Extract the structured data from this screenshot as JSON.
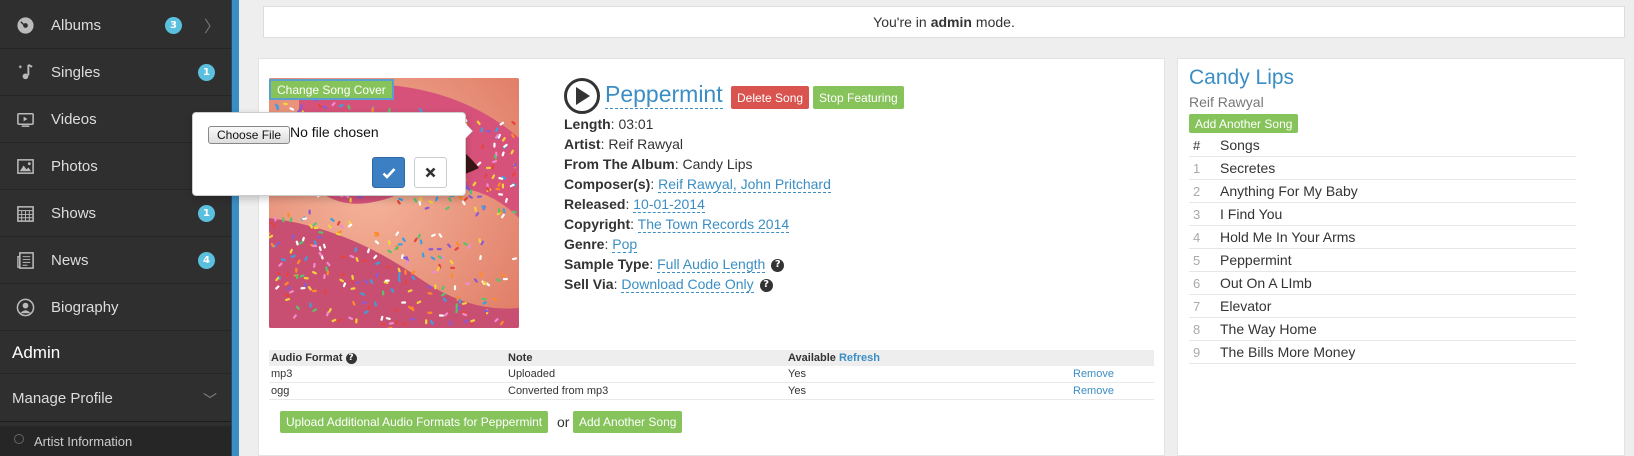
{
  "sidebar": {
    "items": [
      {
        "label": "Albums",
        "icon": "disc-icon",
        "badge": "3",
        "chevron": "〉"
      },
      {
        "label": "Singles",
        "icon": "music-note-icon",
        "badge": "1"
      },
      {
        "label": "Videos",
        "icon": "video-icon",
        "badge": ""
      },
      {
        "label": "Photos",
        "icon": "photo-icon",
        "badge": ""
      },
      {
        "label": "Shows",
        "icon": "calendar-icon",
        "badge": "1"
      },
      {
        "label": "News",
        "icon": "newspaper-icon",
        "badge": "4"
      },
      {
        "label": "Biography",
        "icon": "person-icon",
        "badge": ""
      }
    ],
    "admin_label": "Admin",
    "manage_profile_label": "Manage Profile",
    "manage_chevron": "﹀",
    "artist_information_label": "Artist Information"
  },
  "admin_bar": {
    "prefix": "You're in",
    "mode": "admin",
    "suffix": "mode."
  },
  "cover": {
    "change_label": "Change Song Cover"
  },
  "file_popover": {
    "choose_label": "Choose File",
    "status": "No file chosen",
    "confirm_icon": "check-icon",
    "cancel_icon": "close-icon"
  },
  "song": {
    "title": "Peppermint",
    "delete_label": "Delete Song",
    "stop_featuring_label": "Stop Featuring",
    "meta": [
      {
        "key": "Length",
        "value": "03:01",
        "link": false
      },
      {
        "key": "Artist",
        "value": "Reif Rawyal",
        "link": false
      },
      {
        "key": "From The Album",
        "value": "Candy Lips",
        "link": false
      },
      {
        "key": "Composer(s)",
        "value": "Reif Rawyal, John Pritchard",
        "link": true
      },
      {
        "key": "Released",
        "value": "10-01-2014",
        "link": true
      },
      {
        "key": "Copyright",
        "value": "The Town Records 2014",
        "link": true
      },
      {
        "key": "Genre",
        "value": "Pop",
        "link": true
      },
      {
        "key": "Sample Type",
        "value": "Full Audio Length",
        "link": true,
        "help": "?"
      },
      {
        "key": "Sell Via",
        "value": "Download Code Only",
        "link": true,
        "help": "?"
      }
    ]
  },
  "formats": {
    "headers": {
      "format": "Audio Format",
      "help": "?",
      "note": "Note",
      "available": "Available",
      "refresh": "Refresh"
    },
    "rows": [
      {
        "format": "mp3",
        "note": "Uploaded",
        "available": "Yes",
        "action": "Remove"
      },
      {
        "format": "ogg",
        "note": "Converted from mp3",
        "available": "Yes",
        "action": "Remove"
      }
    ],
    "upload_label": "Upload Additional Audio Formats for Peppermint",
    "or": "or",
    "add_song_label": "Add Another Song"
  },
  "album": {
    "title": "Candy Lips",
    "artist": "Reif Rawyal",
    "add_song_label": "Add Another Song",
    "header_num": "#",
    "header_songs": "Songs",
    "songs": [
      {
        "num": "1",
        "name": "Secretes"
      },
      {
        "num": "2",
        "name": "Anything For My Baby"
      },
      {
        "num": "3",
        "name": "I Find You"
      },
      {
        "num": "4",
        "name": "Hold Me In Your Arms"
      },
      {
        "num": "5",
        "name": "Peppermint"
      },
      {
        "num": "6",
        "name": "Out On A LImb"
      },
      {
        "num": "7",
        "name": "Elevator"
      },
      {
        "num": "8",
        "name": "The Way Home"
      },
      {
        "num": "9",
        "name": "The Bills More Money"
      }
    ]
  },
  "colors": {
    "sidebar_bg": "#2f2f2f",
    "accent_blue": "#3b8ec4",
    "badge": "#5bc0de",
    "green_button": "#86c35a",
    "red_button": "#d9534f"
  }
}
